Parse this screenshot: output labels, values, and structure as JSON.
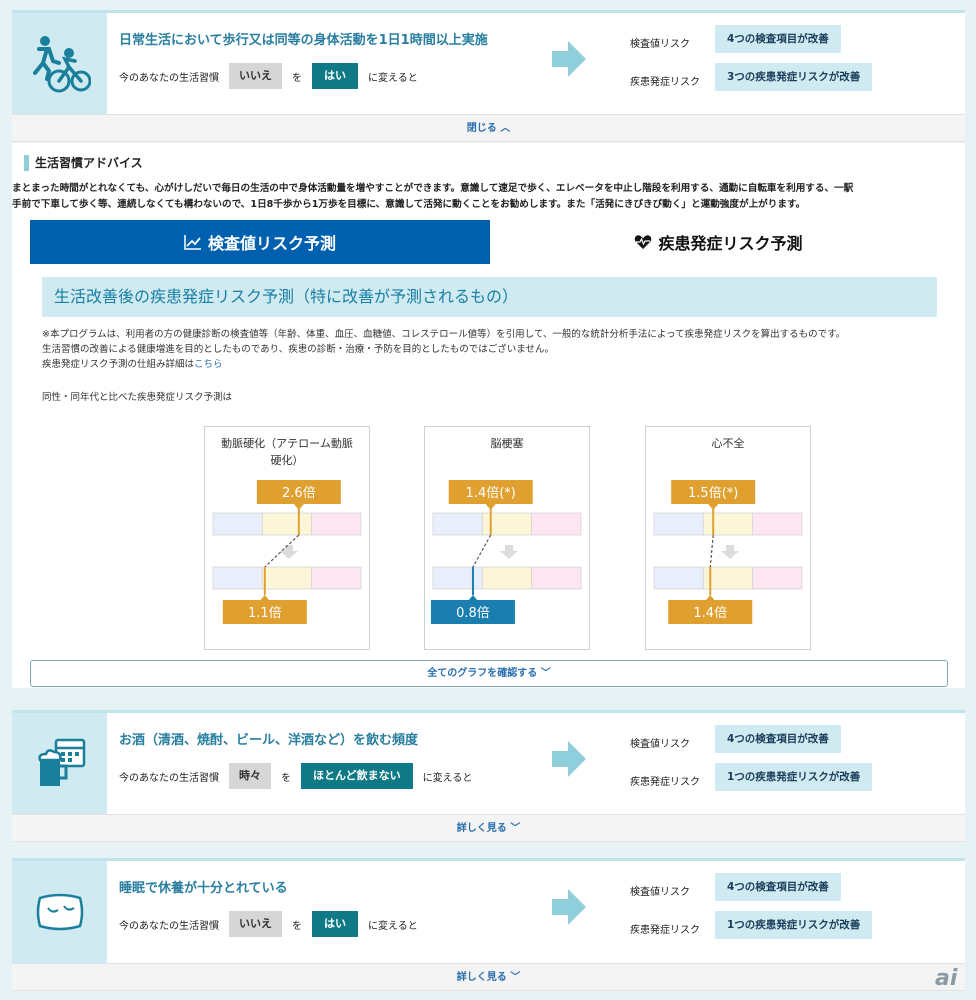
{
  "habits": [
    {
      "title": "日常生活において歩行又は同等の身体活動を1日1時間以上実施",
      "prefix": "今のあなたの生活習慣",
      "current": "いいえ",
      "connector": "を",
      "target": "はい",
      "suffix": "に変えると",
      "test_label": "検査値リスク",
      "test_result": "4つの検査項目が改善",
      "disease_label": "疾患発症リスク",
      "disease_result": "3つの疾患発症リスクが改善",
      "toggle": "閉じる ︿",
      "icon": "exercise-icon"
    },
    {
      "title": "お酒（清酒、焼酎、ビール、洋酒など）を飲む頻度",
      "prefix": "今のあなたの生活習慣",
      "current": "時々",
      "connector": "を",
      "target": "ほとんど飲まない",
      "suffix": "に変えると",
      "test_label": "検査値リスク",
      "test_result": "4つの検査項目が改善",
      "disease_label": "疾患発症リスク",
      "disease_result": "1つの疾患発症リスクが改善",
      "toggle": "詳しく見る ﹀",
      "icon": "alcohol-icon"
    },
    {
      "title": "睡眠で休養が十分とれている",
      "prefix": "今のあなたの生活習慣",
      "current": "いいえ",
      "connector": "を",
      "target": "はい",
      "suffix": "に変えると",
      "test_label": "検査値リスク",
      "test_result": "4つの検査項目が改善",
      "disease_label": "疾患発症リスク",
      "disease_result": "1つの疾患発症リスクが改善",
      "toggle": "詳しく見る ﹀",
      "icon": "pillow-icon"
    }
  ],
  "advice": {
    "heading": "生活習慣アドバイス",
    "line1": "まとまった時間がとれなくても、心がけしだいで毎日の生活の中で身体活動量を増やすことができます。意識して速足で歩く、エレベータを中止し階段を利用する、通勤に自転車を利用する、一駅",
    "line2": "手前で下車して歩く等、連続しなくても構わないので、1日8千歩から1万歩を目標に、意識して活発に動くことをお勧めします。また「活発にきびきび動く」と運動強度が上がります。"
  },
  "tabs": {
    "active": "検査値リスク予測",
    "inactive": "疾患発症リスク予測"
  },
  "panel": {
    "heading": "生活改善後の疾患発症リスク予測（特に改善が予測されるもの）",
    "note1": "※本プログラムは、利用者の方の健康診断の検査値等（年齢、体重、血圧、血糖値、コレステロール値等）を引用して、一般的な統計分析手法によって疾患発症リスクを算出するものです。",
    "note2": "生活習慣の改善による健康増進を目的としたものであり、疾患の診断・治療・予防を目的としたものではございません。",
    "note3_prefix": "疾患発症リスク予測の仕組み詳細は",
    "note3_link": "こちら",
    "compare": "同性・同年代と比べた疾患発症リスク予測は",
    "all_graphs": "全てのグラフを確認する ﹀"
  },
  "graphs": [
    {
      "title_line1": "動脈硬化（アテローム動脈",
      "title_line2": "硬化）",
      "before": "2.6倍",
      "after": "1.1倍",
      "before_pos": 0.58,
      "after_pos": 0.35,
      "after_color": "#e0a030"
    },
    {
      "title_line1": "脳梗塞",
      "title_line2": "",
      "before": "1.4倍(*)",
      "after": "0.8倍",
      "before_pos": 0.39,
      "after_pos": 0.27,
      "after_color": "#1a7fb0"
    },
    {
      "title_line1": "心不全",
      "title_line2": "",
      "before": "1.5倍(*)",
      "after": "1.4倍",
      "before_pos": 0.4,
      "after_pos": 0.38,
      "after_color": "#e0a030"
    }
  ],
  "colors": {
    "accent": "#0060b0",
    "teal": "#0f7a85",
    "risk_box": "#cfeaf0",
    "gold": "#e0a030"
  },
  "logo": "ai"
}
